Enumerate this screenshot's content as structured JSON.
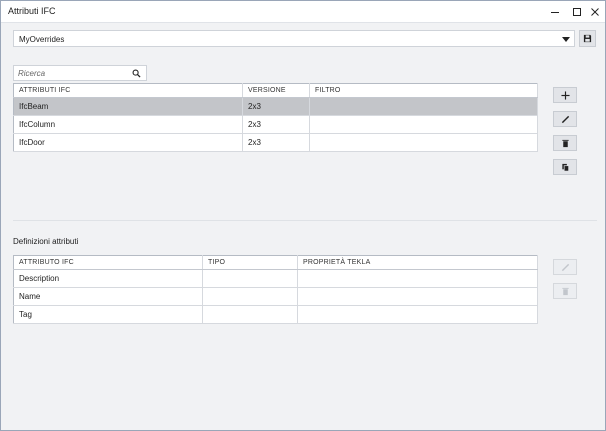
{
  "window": {
    "title": "Attributi IFC"
  },
  "overrides": {
    "selected": "MyOverrides"
  },
  "search": {
    "placeholder": "Ricerca"
  },
  "ifc_table": {
    "headers": [
      "ATTRIBUTI IFC",
      "VERSIONE",
      "FILTRO"
    ],
    "rows": [
      {
        "name": "IfcBeam",
        "version": "2x3",
        "filter": ""
      },
      {
        "name": "IfcColumn",
        "version": "2x3",
        "filter": ""
      },
      {
        "name": "IfcDoor",
        "version": "2x3",
        "filter": ""
      }
    ]
  },
  "definitions": {
    "label": "Definizioni attributi",
    "headers": [
      "ATTRIBUTO IFC",
      "TIPO",
      "PROPRIETÀ TEKLA"
    ],
    "rows": [
      {
        "attribute": "Description",
        "type": "",
        "tekla": ""
      },
      {
        "attribute": "Name",
        "type": "",
        "tekla": ""
      },
      {
        "attribute": "Tag",
        "type": "",
        "tekla": ""
      }
    ]
  },
  "icons": {
    "minimize": "minimize-icon",
    "maximize": "maximize-icon",
    "close": "close-icon",
    "save": "save-icon",
    "search": "search-icon",
    "add": "plus-icon",
    "edit": "pencil-icon",
    "delete": "trash-icon",
    "copy": "copy-icon"
  },
  "colors": {
    "selected_row": "#c3c5c9",
    "border": "#b5bbc4"
  }
}
